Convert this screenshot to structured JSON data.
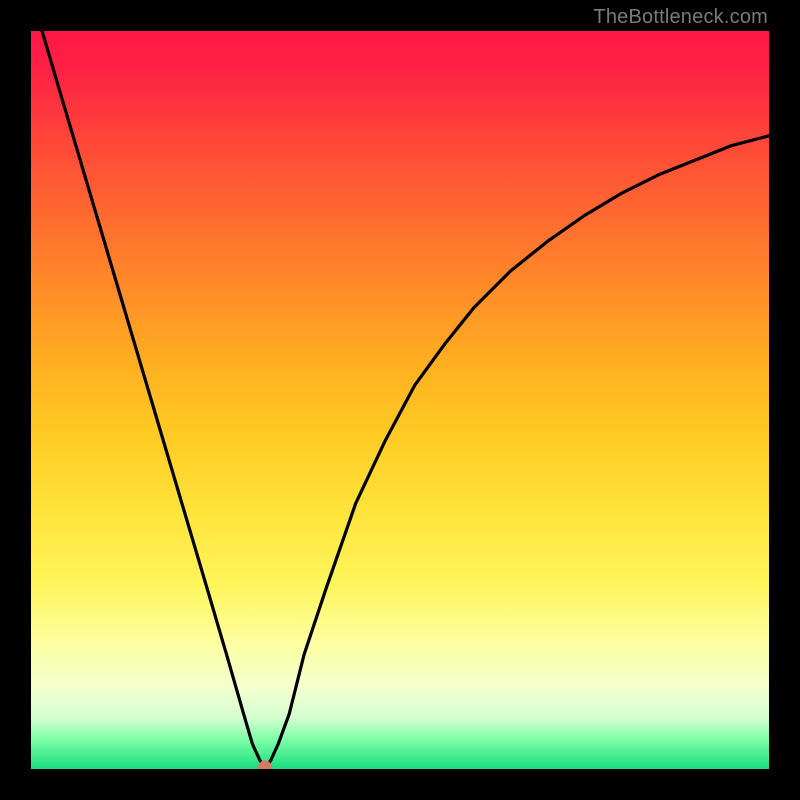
{
  "attribution": "TheBottleneck.com",
  "chart_data": {
    "type": "line",
    "title": "",
    "xlabel": "",
    "ylabel": "",
    "xlim": [
      0,
      1
    ],
    "ylim": [
      0,
      1
    ],
    "background_gradient": {
      "top": "#ff1846",
      "middle": "#ffe33a",
      "bottom": "#19d97e"
    },
    "series": [
      {
        "name": "bottleneck-curve",
        "x": [
          0.015,
          0.04,
          0.08,
          0.12,
          0.16,
          0.2,
          0.24,
          0.265,
          0.288,
          0.3,
          0.31,
          0.315,
          0.317,
          0.32,
          0.325,
          0.335,
          0.35,
          0.37,
          0.4,
          0.44,
          0.48,
          0.52,
          0.56,
          0.6,
          0.65,
          0.7,
          0.75,
          0.8,
          0.85,
          0.9,
          0.95,
          1.0
        ],
        "values": [
          1.0,
          0.915,
          0.78,
          0.645,
          0.51,
          0.375,
          0.24,
          0.155,
          0.075,
          0.034,
          0.012,
          0.005,
          0.002,
          0.005,
          0.012,
          0.034,
          0.075,
          0.155,
          0.245,
          0.36,
          0.445,
          0.52,
          0.575,
          0.625,
          0.675,
          0.715,
          0.75,
          0.78,
          0.805,
          0.825,
          0.845,
          0.858
        ]
      }
    ],
    "marker": {
      "name": "optimal-point",
      "x": 0.317,
      "y": 0.002,
      "color": "#d47a66"
    }
  }
}
